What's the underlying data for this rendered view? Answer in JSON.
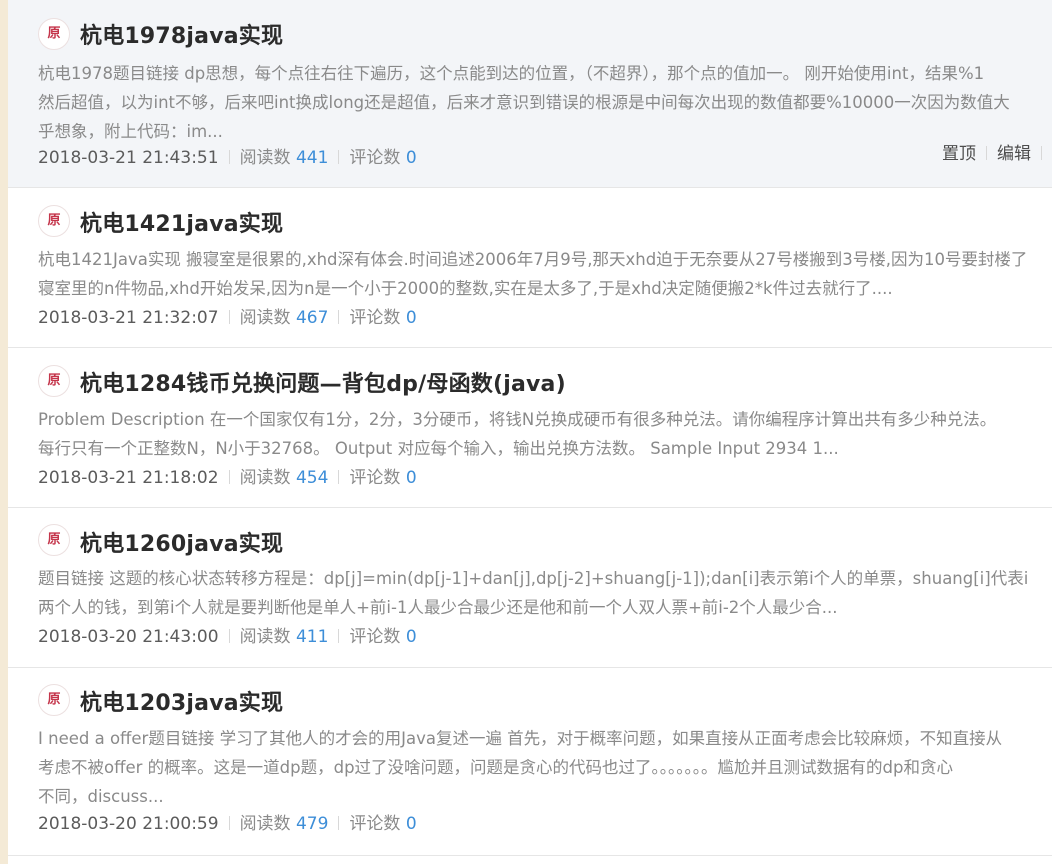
{
  "articles": [
    {
      "badge": "原",
      "title": "杭电1978java实现",
      "summary_lines": [
        "杭电1978题目链接 dp思想，每个点往右往下遍历，这个点能到达的位置，（不超界），那个点的值加一。 刚开始使用int，结果%1",
        "然后超值，以为int不够，后来吧int换成long还是超值，后来才意识到错误的根源是中间每次出现的数值都要%10000一次因为数值大",
        "乎想象，附上代码：im..."
      ],
      "datetime": "2018-03-21 21:43:51",
      "read_label": "阅读数",
      "read_count": "441",
      "comment_label": "评论数",
      "comment_count": "0",
      "ops": {
        "pin": "置顶",
        "edit": "编辑"
      }
    },
    {
      "badge": "原",
      "title": "杭电1421java实现",
      "summary_lines": [
        "杭电1421Java实现 搬寝室是很累的,xhd深有体会.时间追述2006年7月9号,那天xhd迫于无奈要从27号楼搬到3号楼,因为10号要封楼了",
        "寝室里的n件物品,xhd开始发呆,因为n是一个小于2000的整数,实在是太多了,于是xhd决定随便搬2*k件过去就行了...."
      ],
      "datetime": "2018-03-21 21:32:07",
      "read_label": "阅读数",
      "read_count": "467",
      "comment_label": "评论数",
      "comment_count": "0"
    },
    {
      "badge": "原",
      "title": "杭电1284钱币兑换问题—背包dp/母函数(java)",
      "summary_lines": [
        "Problem Description 在一个国家仅有1分，2分，3分硬币，将钱N兑换成硬币有很多种兑法。请你编程序计算出共有多少种兑法。",
        "每行只有一个正整数N，N小于32768。 Output 对应每个输入，输出兑换方法数。 Sample Input 2934 1..."
      ],
      "datetime": "2018-03-21 21:18:02",
      "read_label": "阅读数",
      "read_count": "454",
      "comment_label": "评论数",
      "comment_count": "0"
    },
    {
      "badge": "原",
      "title": "杭电1260java实现",
      "summary_lines": [
        "题目链接 这题的核心状态转移方程是：dp[j]=min(dp[j-1]+dan[j],dp[j-2]+shuang[j-1]);dan[i]表示第i个人的单票，shuang[i]代表i",
        "两个人的钱，到第i个人就是要判断他是单人+前i-1人最少合最少还是他和前一个人双人票+前i-2个人最少合..."
      ],
      "datetime": "2018-03-20 21:43:00",
      "read_label": "阅读数",
      "read_count": "411",
      "comment_label": "评论数",
      "comment_count": "0"
    },
    {
      "badge": "原",
      "title": "杭电1203java实现",
      "summary_lines": [
        "I need a offer题目链接 学习了其他人的才会的用Java复述一遍 首先，对于概率问题，如果直接从正面考虑会比较麻烦，不知直接从",
        "考虑不被offer 的概率。这是一道dp题，dp过了没啥问题，问题是贪心的代码也过了。。。。。。。尴尬并且测试数据有的dp和贪心",
        "不同，discuss..."
      ],
      "datetime": "2018-03-20 21:00:59",
      "read_label": "阅读数",
      "read_count": "479",
      "comment_label": "评论数",
      "comment_count": "0"
    }
  ]
}
